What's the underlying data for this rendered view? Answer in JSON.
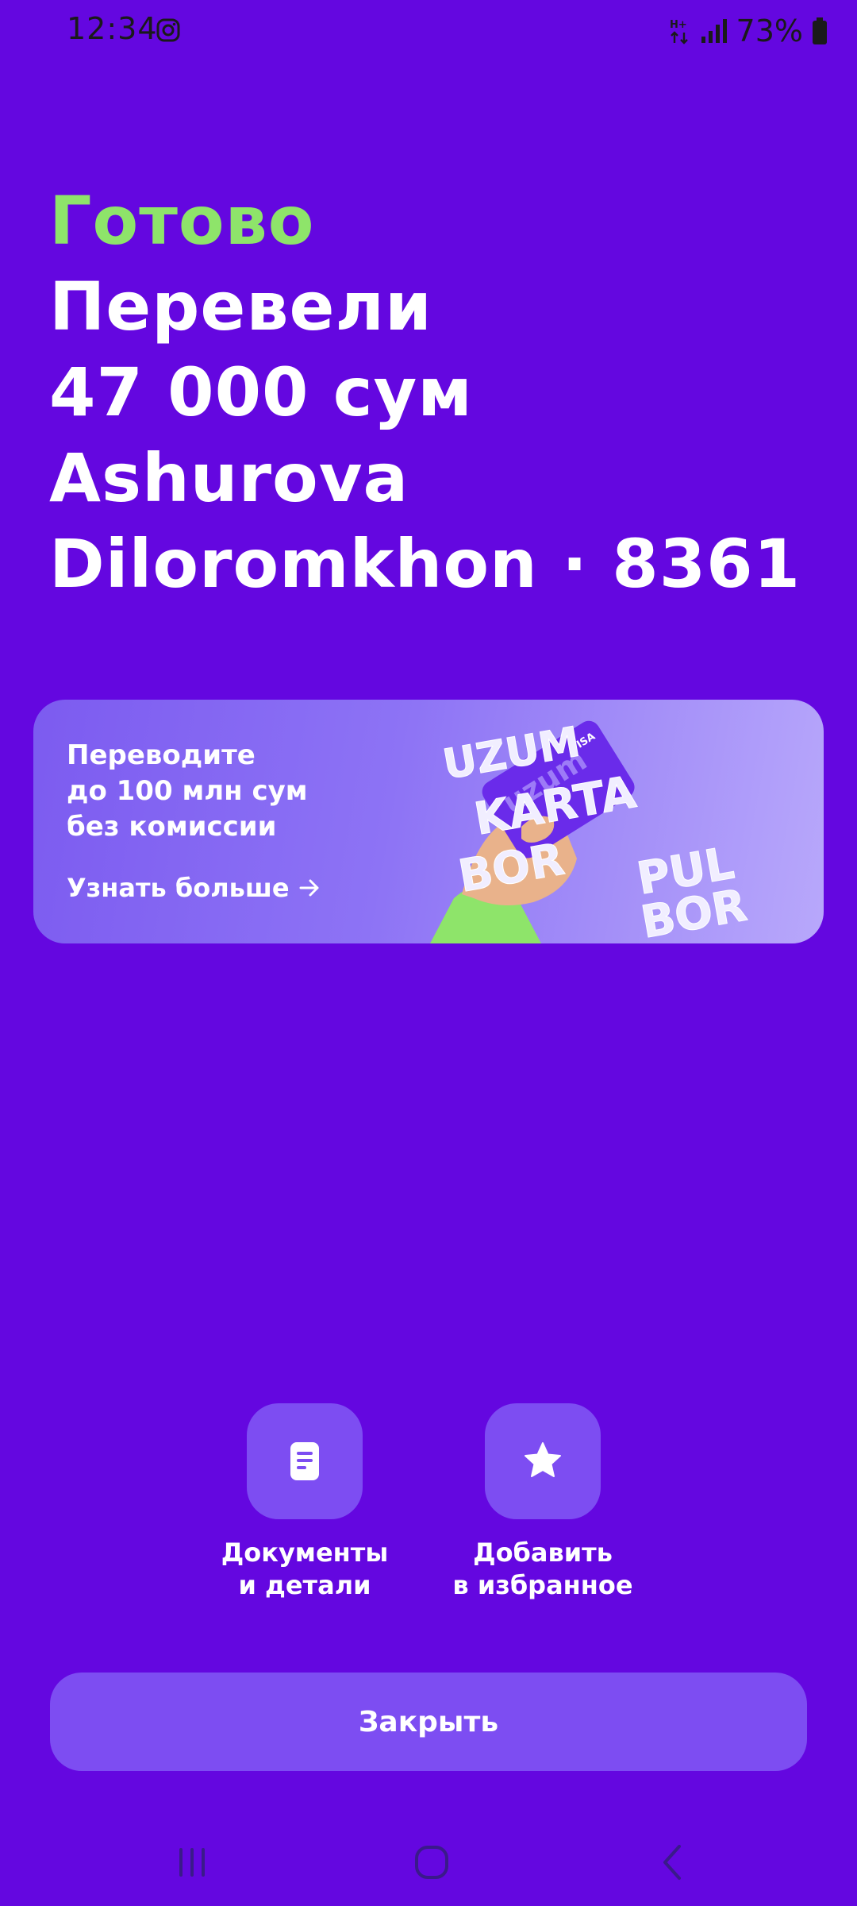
{
  "status_bar": {
    "time": "12:34",
    "network": "H+",
    "battery": "73%"
  },
  "result": {
    "status": "Готово",
    "lines": [
      "Перевели",
      "47 000 сум",
      "Ashurova",
      "Diloromkhon · 8361"
    ]
  },
  "promo": {
    "lines": [
      "Переводите",
      "до 100 млн сум",
      "без комиссии"
    ],
    "link": "Узнать больше",
    "art_text": [
      "UZUM",
      "KARTA",
      "BOR",
      "PUL",
      "BOR",
      "uzum",
      "VISA"
    ]
  },
  "actions": [
    {
      "label": "Документы\nи детали",
      "icon": "document-icon"
    },
    {
      "label": "Добавить\nв избранное",
      "icon": "star-icon"
    }
  ],
  "close_button": {
    "label": "Закрыть"
  },
  "colors": {
    "background": "#6407E0",
    "accent_green": "#8EE46A",
    "button": "#7D4DF2"
  }
}
